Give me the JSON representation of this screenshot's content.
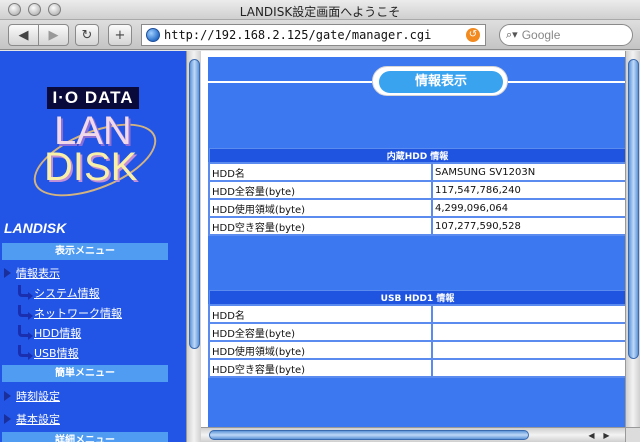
{
  "window": {
    "title": "LANDISK設定画面へようこそ"
  },
  "toolbar": {
    "url": "http://192.168.2.125/gate/manager.cgi",
    "search_placeholder": "Google",
    "back_icon": "back-arrow-icon",
    "forward_icon": "forward-arrow-icon",
    "reload_icon": "reload-icon",
    "add_icon": "plus-icon"
  },
  "sidebar": {
    "brand_io": "I·O DATA",
    "brand_lan": "LAN",
    "brand_disk": "DISK",
    "landisk_label": "LANDISK",
    "sections": [
      {
        "label": "表示メニュー"
      },
      {
        "label": "簡単メニュー"
      },
      {
        "label": "詳細メニュー"
      }
    ],
    "items": [
      {
        "label": "情報表示"
      },
      {
        "label": "システム情報"
      },
      {
        "label": "ネットワーク情報"
      },
      {
        "label": "HDD情報"
      },
      {
        "label": "USB情報"
      },
      {
        "label": "時刻設定"
      },
      {
        "label": "基本設定"
      }
    ]
  },
  "main": {
    "page_title": "情報表示",
    "hdd_table": {
      "header": "内蔵HDD 情報",
      "rows": [
        {
          "key": "HDD名",
          "value": "SAMSUNG SV1203N"
        },
        {
          "key": "HDD全容量(byte)",
          "value": "117,547,786,240"
        },
        {
          "key": "HDD使用領域(byte)",
          "value": "4,299,096,064"
        },
        {
          "key": "HDD空き容量(byte)",
          "value": "107,277,590,528"
        }
      ]
    },
    "usb_table": {
      "header": "USB HDD1 情報",
      "rows": [
        {
          "key": "HDD名",
          "value": ""
        },
        {
          "key": "HDD全容量(byte)",
          "value": ""
        },
        {
          "key": "HDD使用領域(byte)",
          "value": ""
        },
        {
          "key": "HDD空き容量(byte)",
          "value": ""
        }
      ]
    }
  }
}
